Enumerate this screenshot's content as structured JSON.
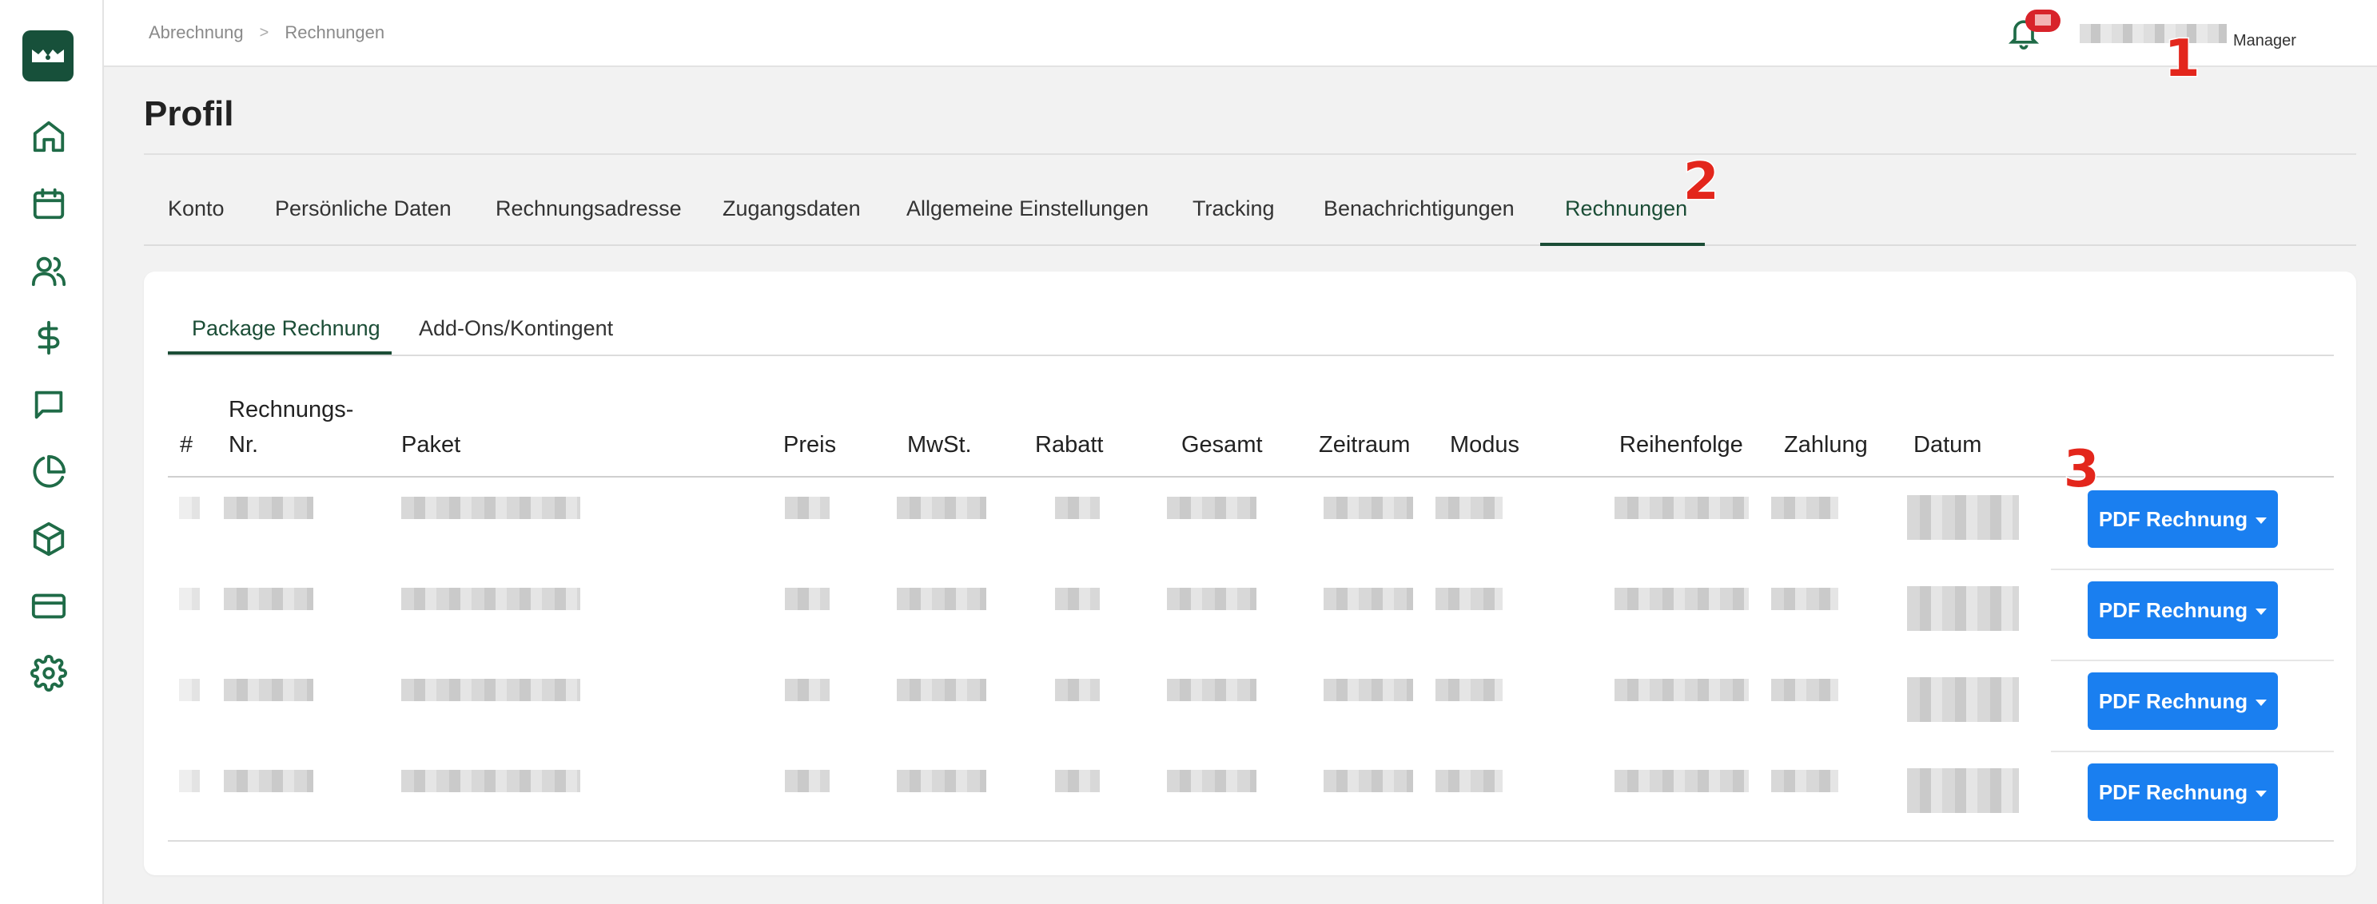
{
  "breadcrumb": {
    "items": [
      "Abrechnung",
      "Rechnungen"
    ],
    "separator": ">"
  },
  "user": {
    "role": "Manager"
  },
  "page": {
    "title": "Profil"
  },
  "tabs": [
    {
      "label": "Konto"
    },
    {
      "label": "Persönliche Daten"
    },
    {
      "label": "Rechnungsadresse"
    },
    {
      "label": "Zugangsdaten"
    },
    {
      "label": "Allgemeine Einstellungen"
    },
    {
      "label": "Tracking"
    },
    {
      "label": "Benachrichtigungen"
    },
    {
      "label": "Rechnungen",
      "active": true
    }
  ],
  "subtabs": [
    {
      "label": "Package Rechnung",
      "active": true
    },
    {
      "label": "Add-Ons/Kontingent"
    }
  ],
  "table": {
    "headers": {
      "num": "#",
      "rechnungsnr_line1": "Rechnungs-",
      "rechnungsnr_line2": "Nr.",
      "paket": "Paket",
      "preis": "Preis",
      "mwst": "MwSt.",
      "rabatt": "Rabatt",
      "gesamt": "Gesamt",
      "zeitraum": "Zeitraum",
      "modus": "Modus",
      "reihenfolge": "Reihenfolge",
      "zahlung": "Zahlung",
      "datum": "Datum"
    },
    "row_action_label": "PDF Rechnung"
  },
  "markers": [
    "1",
    "2",
    "3"
  ],
  "colors": {
    "brand": "#17503a",
    "accent": "#1a7ff0",
    "marker": "#e3261c"
  },
  "icons": [
    "logo-icon",
    "home-icon",
    "calendar-icon",
    "users-icon",
    "dollar-icon",
    "chat-icon",
    "pie-chart-icon",
    "box-icon",
    "credit-card-icon",
    "settings-icon",
    "bell-icon",
    "user-icon"
  ]
}
